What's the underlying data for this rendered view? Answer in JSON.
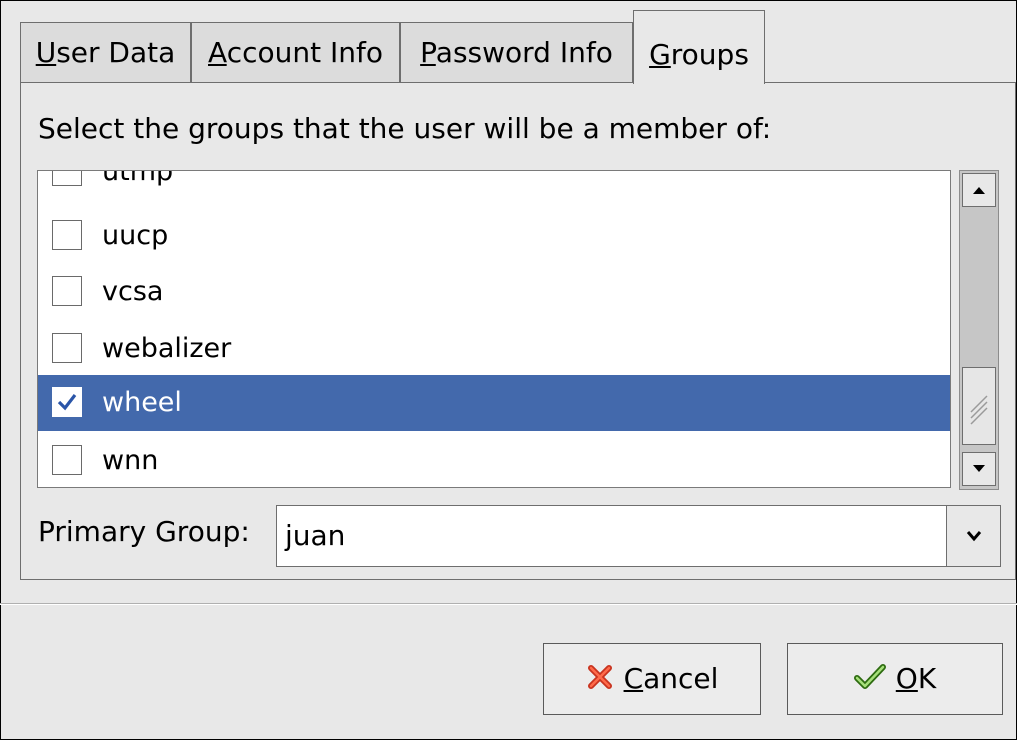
{
  "tabs": [
    {
      "mn": "U",
      "rest": "ser Data"
    },
    {
      "mn": "A",
      "rest": "ccount Info"
    },
    {
      "mn": "P",
      "rest": "assword Info"
    },
    {
      "mn": "G",
      "rest": "roups"
    }
  ],
  "active_tab": "Groups",
  "instruction": "Select the groups that the user will be a member of:",
  "groups": [
    {
      "name": "utmp",
      "checked": false
    },
    {
      "name": "uucp",
      "checked": false
    },
    {
      "name": "vcsa",
      "checked": false
    },
    {
      "name": "webalizer",
      "checked": false
    },
    {
      "name": "wheel",
      "checked": true
    },
    {
      "name": "wnn",
      "checked": false
    }
  ],
  "selected_group": "wheel",
  "primary_group": {
    "label": "Primary Group:",
    "value": "juan"
  },
  "buttons": {
    "cancel": {
      "mn": "C",
      "rest": "ancel"
    },
    "ok": {
      "mn": "O",
      "rest": "K"
    }
  },
  "colors": {
    "selection": "#4369ac",
    "window": "#e8e8e8"
  }
}
